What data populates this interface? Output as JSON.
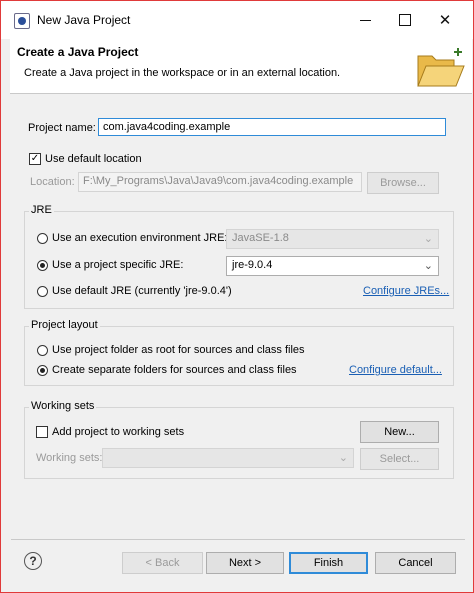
{
  "window": {
    "title": "New Java Project"
  },
  "header": {
    "title": "Create a Java Project",
    "description": "Create a Java project in the workspace or in an external location."
  },
  "project": {
    "name_label": "Project name:",
    "name_value": "com.java4coding.example",
    "use_default_location_label": "Use default location",
    "use_default_location_checked": true,
    "location_label": "Location:",
    "location_value": "F:\\My_Programs\\Java\\Java9\\com.java4coding.example",
    "browse_label": "Browse..."
  },
  "jre": {
    "group_title": "JRE",
    "option_env_label": "Use an execution environment JRE:",
    "env_value": "JavaSE-1.8",
    "option_specific_label": "Use a project specific JRE:",
    "specific_value": "jre-9.0.4",
    "option_default_label": "Use default JRE (currently 'jre-9.0.4')",
    "configure_link": "Configure JREs...",
    "selected": "specific"
  },
  "layout": {
    "group_title": "Project layout",
    "option_root_label": "Use project folder as root for sources and class files",
    "option_separate_label": "Create separate folders for sources and class files",
    "configure_link": "Configure default...",
    "selected": "separate"
  },
  "working_sets": {
    "group_title": "Working sets",
    "add_label": "Add project to working sets",
    "add_checked": false,
    "new_button": "New...",
    "sets_label": "Working sets:",
    "select_button": "Select..."
  },
  "footer": {
    "back_button": "< Back",
    "next_button": "Next >",
    "finish_button": "Finish",
    "cancel_button": "Cancel"
  },
  "icons": {
    "app": "eclipse-app-icon",
    "banner": "open-folder-icon",
    "help": "help-icon",
    "minimize": "minimize-icon",
    "maximize": "maximize-icon",
    "close": "close-icon"
  }
}
